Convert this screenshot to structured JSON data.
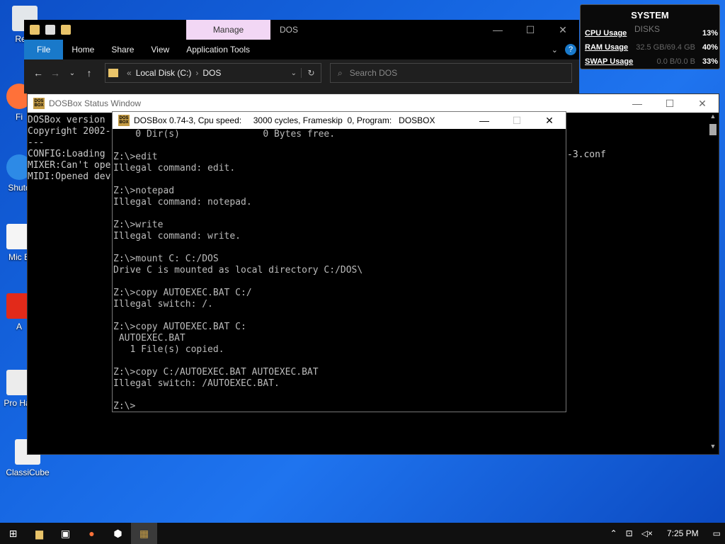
{
  "desktop": {
    "icons": [
      {
        "label": "Recy",
        "name": "recycle-bin",
        "color": "#e3e7ea"
      },
      {
        "label": "Fi",
        "name": "firefox",
        "color": "#ff7139"
      },
      {
        "label": "Shutd",
        "name": "shutdown",
        "color": "#2d8ae6"
      },
      {
        "label": "Mic E",
        "name": "microsoft-edge",
        "color": "#f5f5f5"
      },
      {
        "label": "A",
        "name": "acrobat",
        "color": "#e22a1a"
      },
      {
        "label": "Pro Hac",
        "name": "process-hacker",
        "color": "#ececec"
      },
      {
        "label": "ClassiCube",
        "name": "classicube",
        "color": "#f0f0f0"
      }
    ]
  },
  "explorer": {
    "manage_tab": "Manage",
    "title": "DOS",
    "ribbon_tabs": [
      "File",
      "Home",
      "Share",
      "View",
      "Application Tools"
    ],
    "help": "?",
    "address": {
      "root": "Local Disk (C:)",
      "folder": "DOS"
    },
    "search_placeholder": "Search DOS",
    "controls": {
      "minimize": "—",
      "maximize": "☐",
      "close": "✕"
    }
  },
  "status_window": {
    "title": "DOSBox Status Window",
    "lines": [
      "DOSBox version",
      "Copyright 2002-",
      "---",
      "CONFIG:Loading",
      "MIXER:Can't ope",
      "MIDI:Opened dev"
    ],
    "config_tail": "-3.conf"
  },
  "dosbox": {
    "title": "DOSBox 0.74-3, Cpu speed:     3000 cycles, Frameskip  0, Program:   DOSBOX",
    "terminal": "    0 Dir(s)               0 Bytes free.\n\nZ:\\>edit\nIllegal command: edit.\n\nZ:\\>notepad\nIllegal command: notepad.\n\nZ:\\>write\nIllegal command: write.\n\nZ:\\>mount C: C:/DOS\nDrive C is mounted as local directory C:/DOS\\\n\nZ:\\>copy AUTOEXEC.BAT C:/\nIllegal switch: /.\n\nZ:\\>copy AUTOEXEC.BAT C:\n AUTOEXEC.BAT\n   1 File(s) copied.\n\nZ:\\>copy C:/AUTOEXEC.BAT AUTOEXEC.BAT\nIllegal switch: /AUTOEXEC.BAT.\n\nZ:\\>"
  },
  "system_monitor": {
    "title": "SYSTEM",
    "disks": "DISKS",
    "rows": [
      {
        "label": "CPU Usage",
        "detail": "",
        "percent": "13%"
      },
      {
        "label": "RAM Usage",
        "detail": "32.5 GB/69.4 GB",
        "percent": "40%"
      },
      {
        "label": "SWAP Usage",
        "detail": "0.0 B/0.0 B",
        "percent": "33%"
      }
    ]
  },
  "taskbar": {
    "clock": "7:25 PM"
  }
}
